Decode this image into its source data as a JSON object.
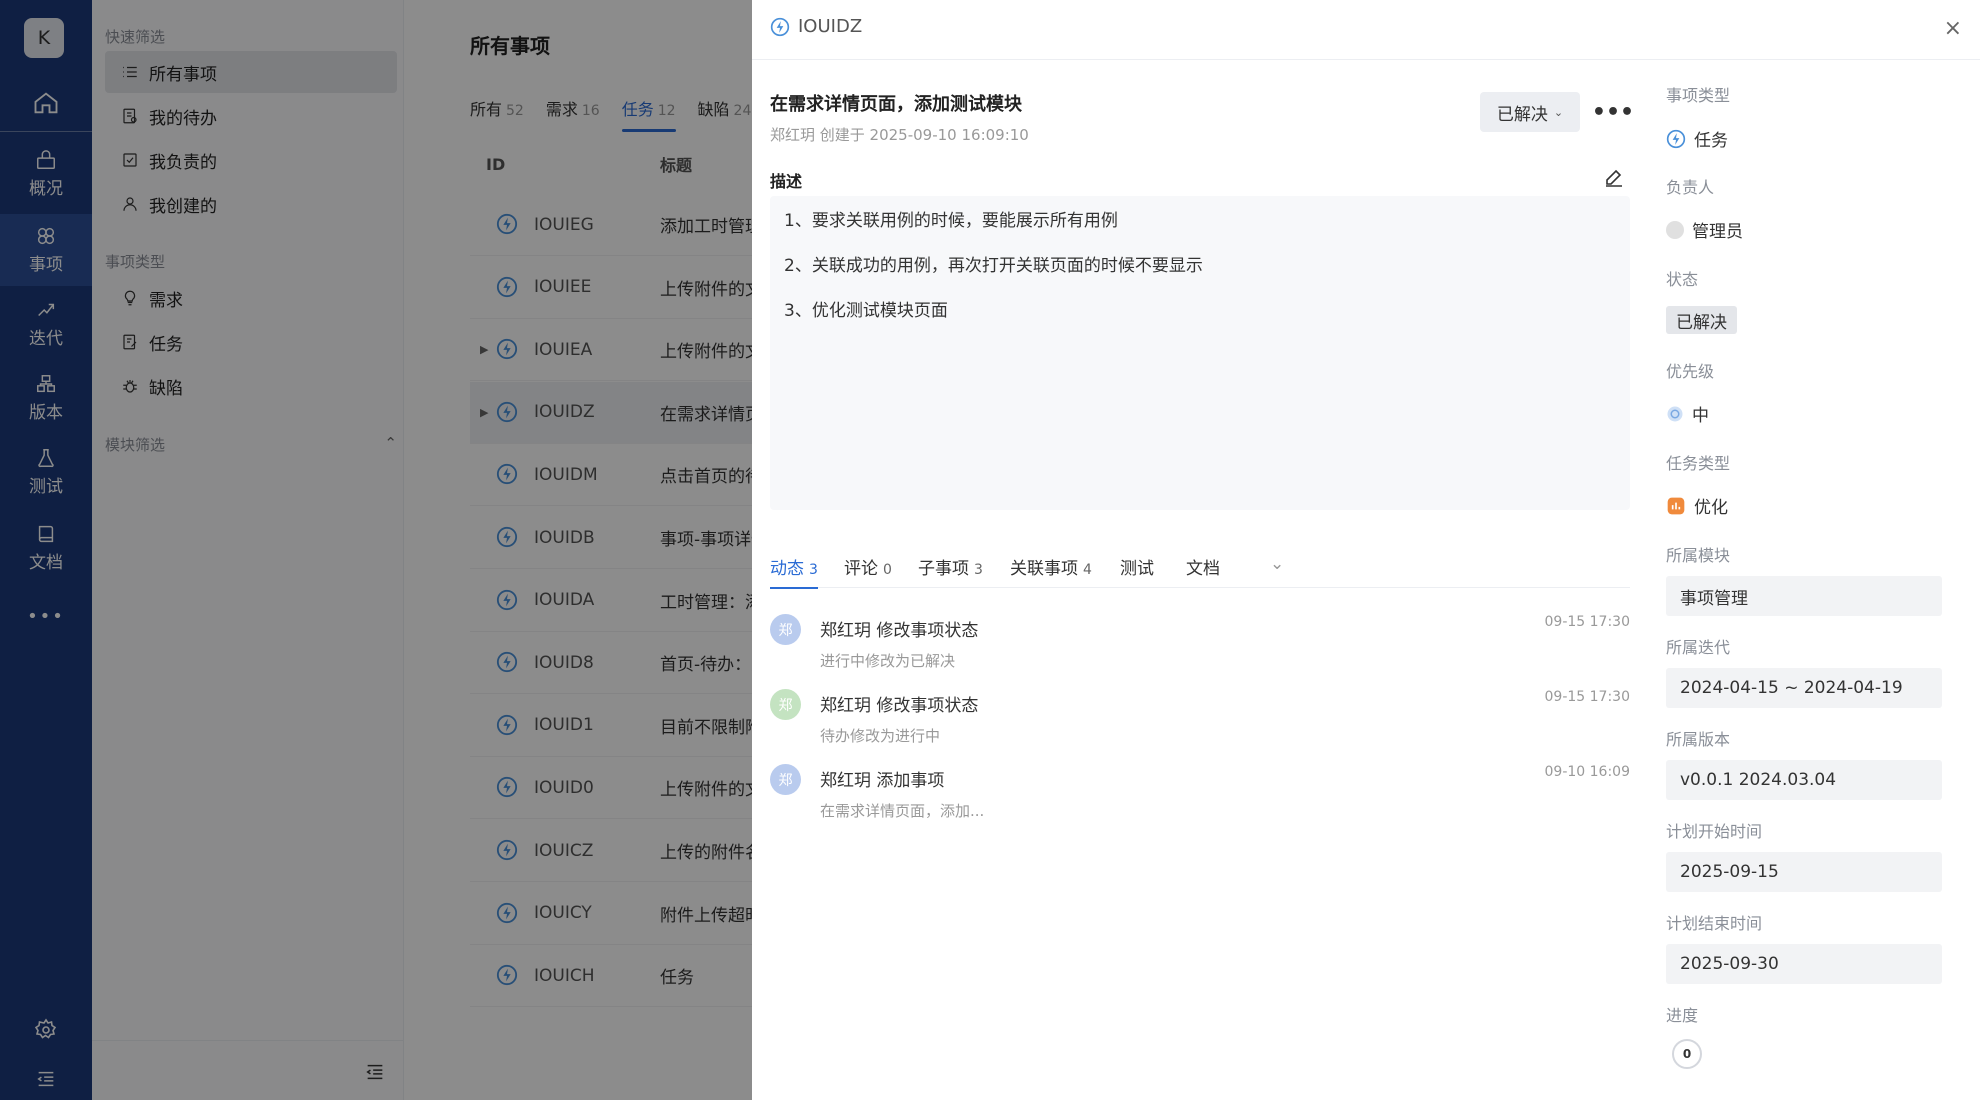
{
  "rail": {
    "avatar_letter": "K",
    "items": [
      {
        "label": "概况"
      },
      {
        "label": "事项"
      },
      {
        "label": "迭代"
      },
      {
        "label": "版本"
      },
      {
        "label": "测试"
      },
      {
        "label": "文档"
      }
    ],
    "more": "•••"
  },
  "sidebar": {
    "quick_heading": "快速筛选",
    "quick_items": [
      {
        "label": "所有事项"
      },
      {
        "label": "我的待办"
      },
      {
        "label": "我负责的"
      },
      {
        "label": "我创建的"
      }
    ],
    "type_heading": "事项类型",
    "type_items": [
      {
        "label": "需求"
      },
      {
        "label": "任务"
      },
      {
        "label": "缺陷"
      }
    ],
    "module_heading": "模块筛选"
  },
  "main": {
    "title": "所有事项",
    "tabs": [
      {
        "label": "所有",
        "count": "52"
      },
      {
        "label": "需求",
        "count": "16"
      },
      {
        "label": "任务",
        "count": "12"
      },
      {
        "label": "缺陷",
        "count": "24"
      }
    ],
    "columns": {
      "id": "ID",
      "title": "标题"
    },
    "rows": [
      {
        "id": "IOUIEG",
        "title": "添加工时管理"
      },
      {
        "id": "IOUIEE",
        "title": "上传附件的文件"
      },
      {
        "id": "IOUIEA",
        "title": "上传附件的文件"
      },
      {
        "id": "IOUIDZ",
        "title": "在需求详情页面"
      },
      {
        "id": "IOUIDM",
        "title": "点击首页的待办"
      },
      {
        "id": "IOUIDB",
        "title": "事项-事项详情"
      },
      {
        "id": "IOUIDA",
        "title": "工时管理：添加"
      },
      {
        "id": "IOUID8",
        "title": "首页-待办：点击"
      },
      {
        "id": "IOUID1",
        "title": "目前不限制附件"
      },
      {
        "id": "IOUID0",
        "title": "上传附件的文件"
      },
      {
        "id": "IOUICZ",
        "title": "上传的附件名称"
      },
      {
        "id": "IOUICY",
        "title": "附件上传超时"
      },
      {
        "id": "IOUICH",
        "title": "任务"
      }
    ]
  },
  "detail": {
    "id": "IOUIDZ",
    "title": "在需求详情页面，添加测试模块",
    "meta": "郑红玥 创建于 2025-09-10 16:09:10",
    "status_button": "已解决",
    "more": "•••",
    "close": "×",
    "desc_label": "描述",
    "desc_lines": [
      "1、要求关联用例的时候，要能展示所有用例",
      "2、关联成功的用例，再次打开关联页面的时候不要显示",
      "3、优化测试模块页面"
    ],
    "tabs": [
      {
        "label": "动态",
        "count": "3"
      },
      {
        "label": "评论",
        "count": "0"
      },
      {
        "label": "子事项",
        "count": "3"
      },
      {
        "label": "关联事项",
        "count": "4"
      },
      {
        "label": "测试",
        "count": ""
      },
      {
        "label": "文档",
        "count": ""
      }
    ],
    "activities": [
      {
        "avatar": "郑",
        "color": "#b9cbee",
        "title": "郑红玥 修改事项状态",
        "sub": "进行中修改为已解决",
        "time": "09-15 17:30"
      },
      {
        "avatar": "郑",
        "color": "#c4e3c1",
        "title": "郑红玥 修改事项状态",
        "sub": "待办修改为进行中",
        "time": "09-15 17:30"
      },
      {
        "avatar": "郑",
        "color": "#b9cbee",
        "title": "郑红玥 添加事项",
        "sub": "在需求详情页面，添加...",
        "time": "09-10 16:09"
      }
    ]
  },
  "fields": {
    "type_label": "事项类型",
    "type_value": "任务",
    "assignee_label": "负责人",
    "assignee_value": "管理员",
    "status_label": "状态",
    "status_value": "已解决",
    "priority_label": "优先级",
    "priority_value": "中",
    "task_type_label": "任务类型",
    "task_type_value": "优化",
    "module_label": "所属模块",
    "module_value": "事项管理",
    "sprint_label": "所属迭代",
    "sprint_value": "2024-04-15 ~ 2024-04-19",
    "version_label": "所属版本",
    "version_value": "v0.0.1 2024.03.04",
    "start_label": "计划开始时间",
    "start_value": "2025-09-15",
    "end_label": "计划结束时间",
    "end_value": "2025-09-30",
    "progress_label": "进度",
    "progress_value": "0"
  },
  "colors": {
    "accent": "#2a6bd4",
    "rail": "#1d3a7a",
    "task_icon": "#4a90d9",
    "optimize_tag": "#f08a3c"
  }
}
